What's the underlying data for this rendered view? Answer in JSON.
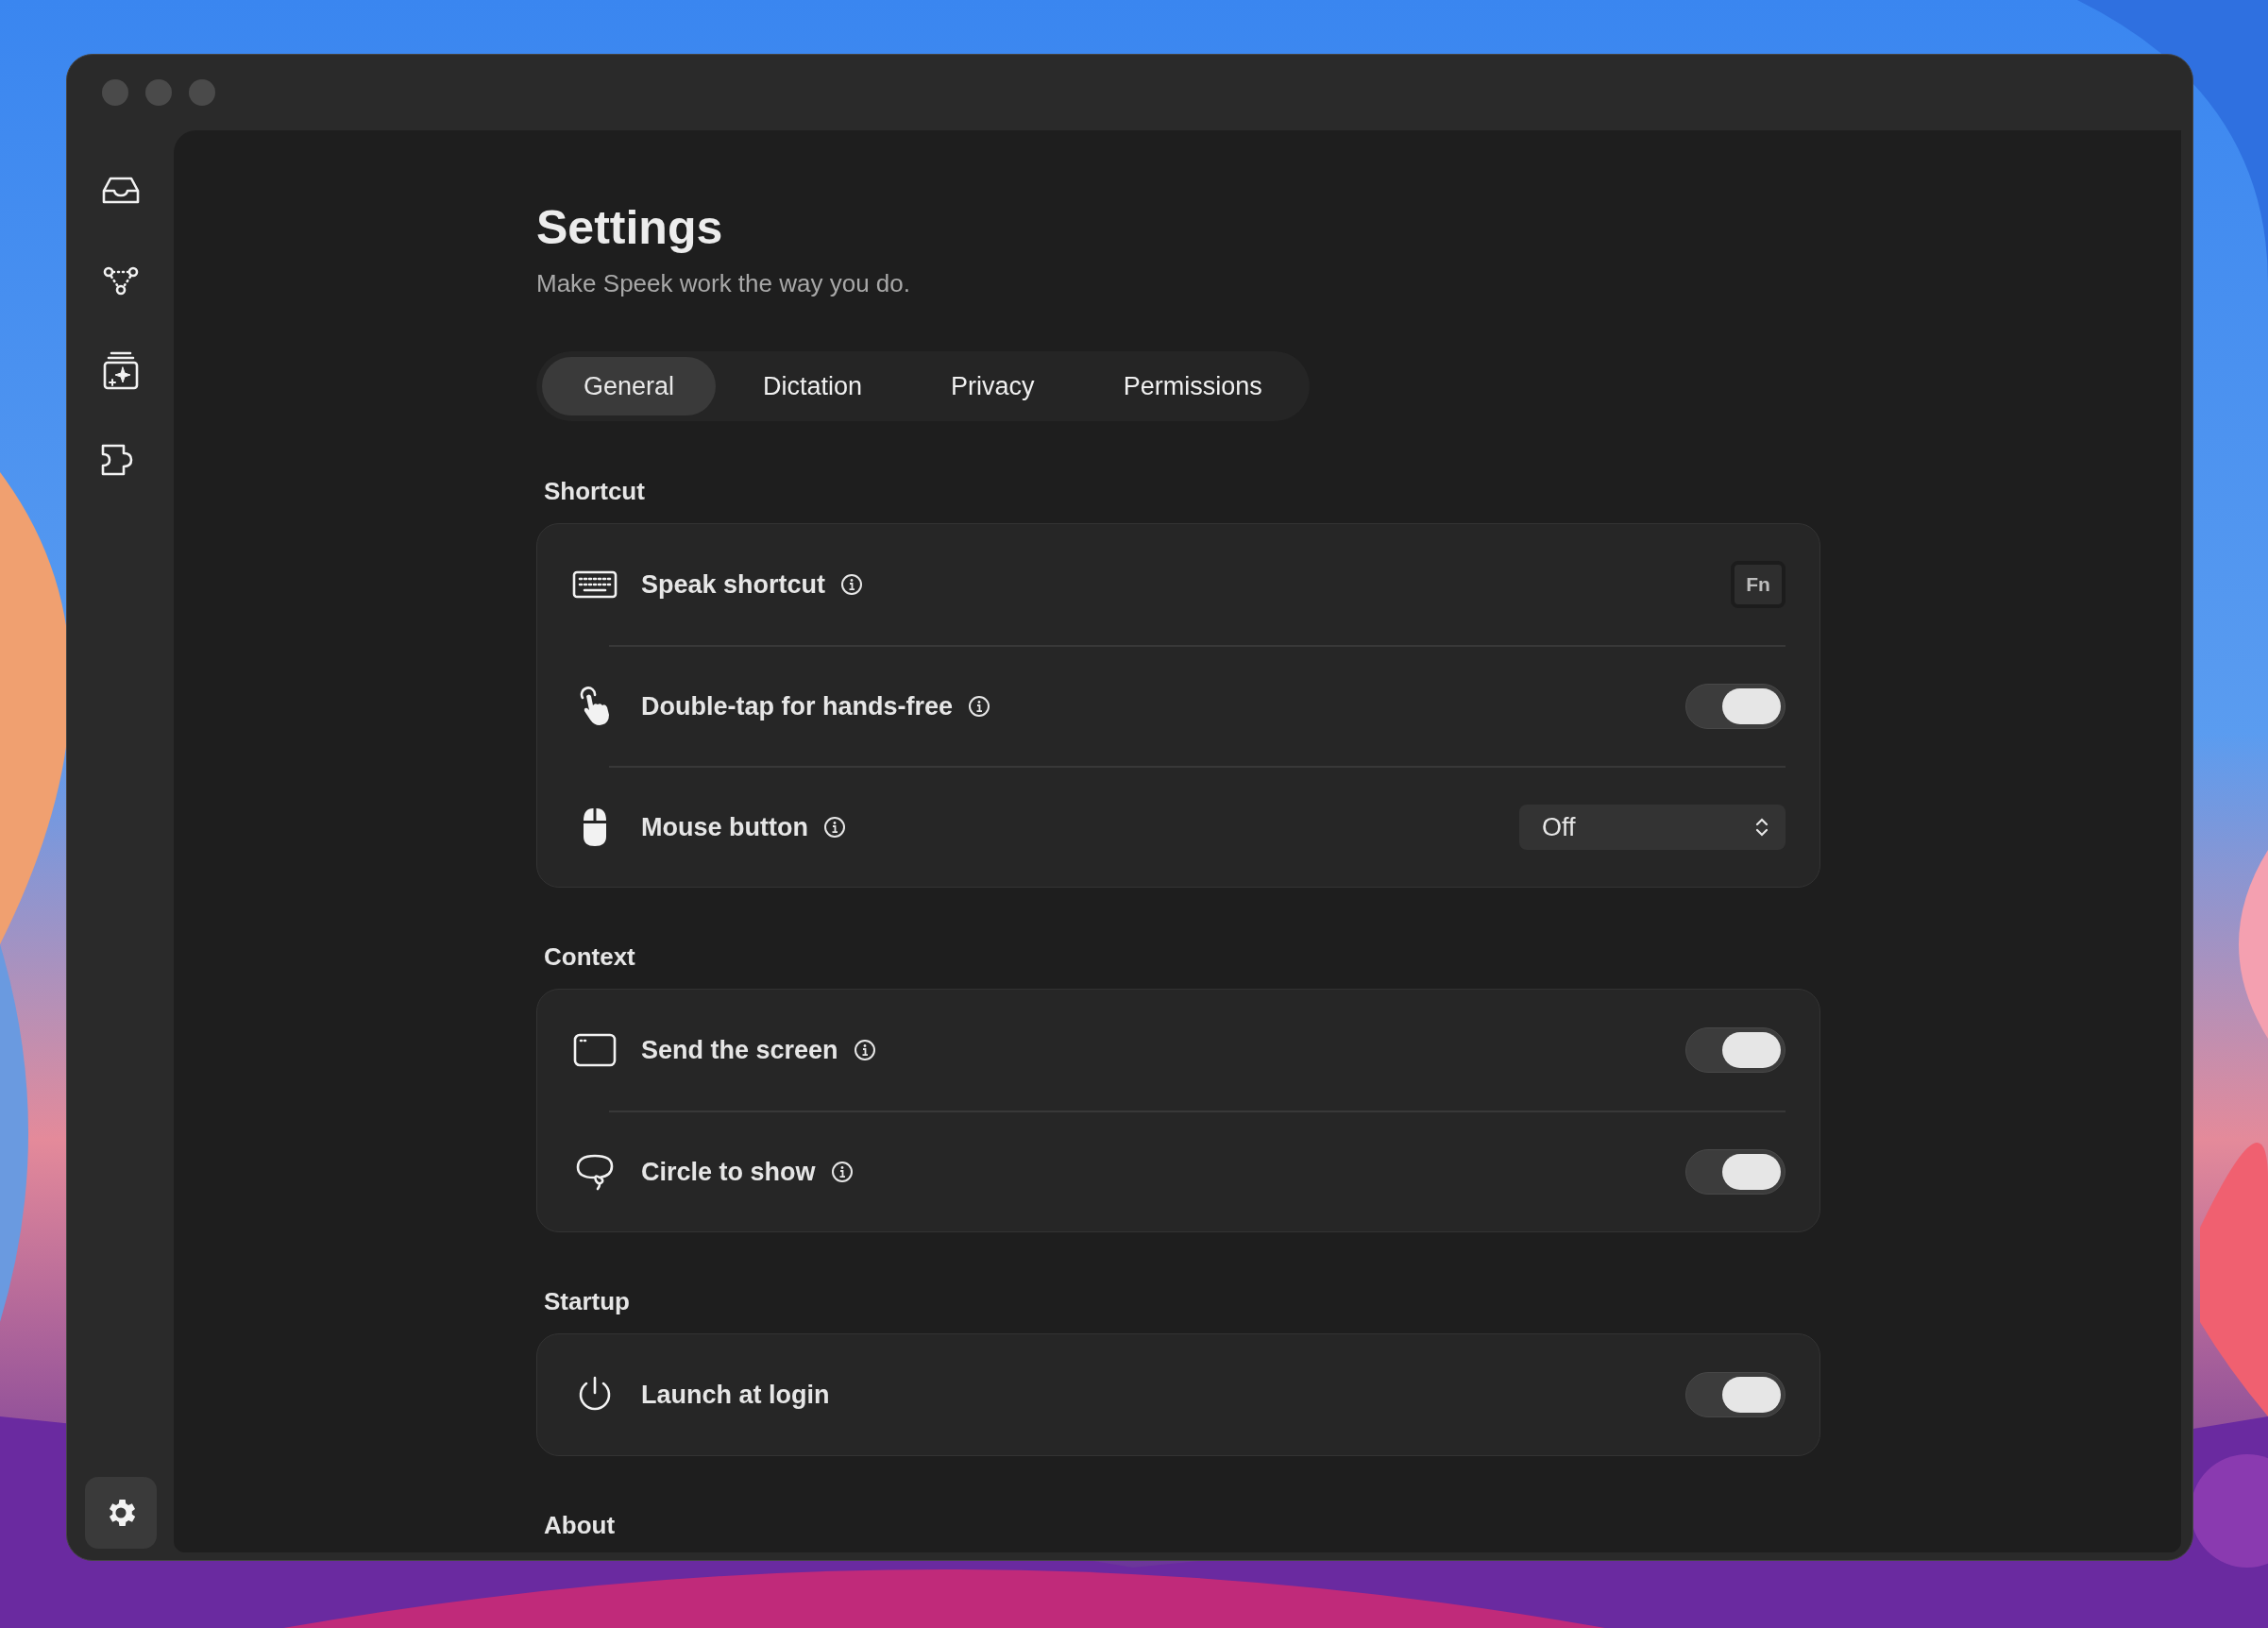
{
  "sidebar": {
    "items": [
      {
        "kind": "inbox",
        "selected": false
      },
      {
        "kind": "nodes",
        "selected": false
      },
      {
        "kind": "sparkle-stack",
        "selected": false
      },
      {
        "kind": "puzzle",
        "selected": false
      }
    ],
    "footer": {
      "kind": "gear",
      "selected": true
    }
  },
  "header": {
    "title": "Settings",
    "subtitle": "Make Speek work the way you do."
  },
  "tabs": [
    {
      "label": "General",
      "selected": true
    },
    {
      "label": "Dictation",
      "selected": false
    },
    {
      "label": "Privacy",
      "selected": false
    },
    {
      "label": "Permissions",
      "selected": false
    }
  ],
  "sections": [
    {
      "heading": "Shortcut",
      "rows": [
        {
          "kind": "key",
          "label": "Speak shortcut",
          "info": true,
          "key": "Fn"
        },
        {
          "kind": "toggle",
          "label": "Double-tap for hands-free",
          "info": true,
          "on": true
        },
        {
          "kind": "select",
          "label": "Mouse button",
          "info": true,
          "value": "Off"
        }
      ]
    },
    {
      "heading": "Context",
      "rows": [
        {
          "kind": "toggle",
          "label": "Send the screen",
          "info": true,
          "on": true
        },
        {
          "kind": "toggle",
          "label": "Circle to show",
          "info": true,
          "on": true
        }
      ]
    },
    {
      "heading": "Startup",
      "rows": [
        {
          "kind": "toggle",
          "label": "Launch at login",
          "info": false,
          "on": true
        }
      ]
    },
    {
      "heading": "About"
    }
  ]
}
